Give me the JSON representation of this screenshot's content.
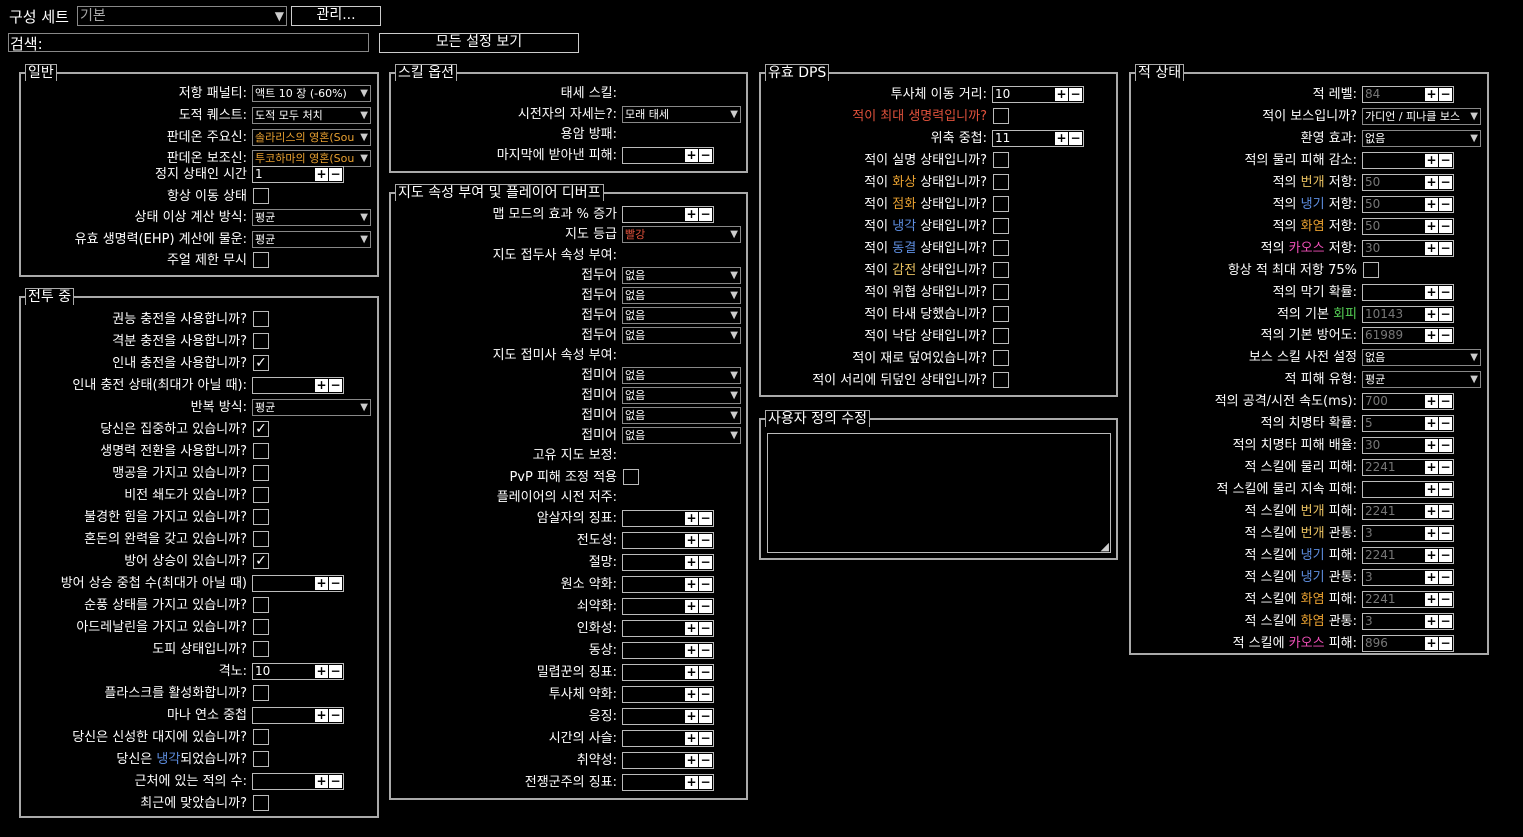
{
  "topbar": {
    "build_label": "구성 세트",
    "build_value": "기본",
    "manage_button": "관리...",
    "search_label": "검색:",
    "search_value": "",
    "show_all_button": "모든 설정 보기"
  },
  "general": {
    "title": "일반",
    "rows": [
      {
        "label": "저항 패널티:",
        "type": "dropdown",
        "value": "액트 10 장 (-60%)"
      },
      {
        "label": "도적 퀘스트:",
        "type": "dropdown",
        "value": "도적 모두 처치"
      },
      {
        "label": "판데온 주요신:",
        "type": "dropdown",
        "value": "솔라리스의 영혼(Sou",
        "color": "#e8a030"
      },
      {
        "label": "판데온 보조신:",
        "type": "dropdown",
        "value": "투코하마의 영혼(Sou",
        "color": "#e8a030"
      },
      {
        "label": "정지 상태인 시간",
        "type": "number",
        "value": "1"
      },
      {
        "label": "항상 이동 상태",
        "type": "check",
        "checked": false
      },
      {
        "label": "상태 이상 계산 방식:",
        "type": "dropdown",
        "value": "평균"
      },
      {
        "label": "유효 생명력(EHP) 계산에 물운:",
        "type": "dropdown",
        "value": "평균"
      },
      {
        "label": "주얼 제한 무시",
        "type": "check",
        "checked": false
      }
    ]
  },
  "combat": {
    "title": "전투 중",
    "rows": [
      {
        "label": "권능 충전을 사용합니까?",
        "type": "check",
        "checked": false
      },
      {
        "label": "격분 충전을 사용합니까?",
        "type": "check",
        "checked": false
      },
      {
        "label": "인내 충전을 사용합니까?",
        "type": "check",
        "checked": true
      },
      {
        "label": "인내 충전 상태(최대가 아닐 때):",
        "type": "number",
        "value": ""
      },
      {
        "label": "반복 방식:",
        "type": "dropdown",
        "value": "평균"
      },
      {
        "label": "당신은 집중하고 있습니까?",
        "type": "check",
        "checked": true
      },
      {
        "label": "생명력 전환을 사용합니까?",
        "type": "check",
        "checked": false
      },
      {
        "label": "맹공을 가지고 있습니까?",
        "type": "check",
        "checked": false
      },
      {
        "label": "비전 쇄도가 있습니까?",
        "type": "check",
        "checked": false
      },
      {
        "label": "불경한 힘을 가지고 있습니까?",
        "type": "check",
        "checked": false
      },
      {
        "label": "혼돈의 완력을 갖고 있습니까?",
        "type": "check",
        "checked": false
      },
      {
        "label": "방어 상승이 있습니까?",
        "type": "check",
        "checked": true
      },
      {
        "label": "방어 상승 중첩 수(최대가 아닐 때)",
        "type": "number",
        "value": ""
      },
      {
        "label": "순풍 상태를 가지고 있습니까?",
        "type": "check",
        "checked": false
      },
      {
        "label": "아드레날린을 가지고 있습니까?",
        "type": "check",
        "checked": false
      },
      {
        "label": "도피 상태입니까?",
        "type": "check",
        "checked": false
      },
      {
        "label": "격노:",
        "type": "number",
        "value": "10"
      },
      {
        "label": "플라스크를 활성화합니까?",
        "type": "check",
        "checked": false
      },
      {
        "label": "마나 연소 중첩",
        "type": "number",
        "value": ""
      },
      {
        "label": "당신은 신성한 대지에 있습니까?",
        "type": "check",
        "checked": false
      },
      {
        "label_parts": [
          "당신은 ",
          "냉각",
          "되었습니까?"
        ],
        "type": "check",
        "checked": false
      },
      {
        "label": "근처에 있는 적의 수:",
        "type": "number",
        "value": ""
      },
      {
        "label": "최근에 맞았습니까?",
        "type": "check",
        "checked": false
      }
    ]
  },
  "skill_options": {
    "title": "스킬 옵션",
    "rows": [
      {
        "label": "태세 스킬:",
        "type": "none"
      },
      {
        "label": "시전자의 자세는?:",
        "type": "dropdown",
        "value": "모래 태세"
      },
      {
        "label": "용암 방패:",
        "type": "none"
      },
      {
        "label": "마지막에 받아낸 피해:",
        "type": "number",
        "value": ""
      }
    ]
  },
  "map_mods": {
    "title": "지도 속성 부여 및 플레이어 디버프",
    "rows": [
      {
        "label": "맵 모드의 효과 % 증가",
        "type": "number",
        "value": ""
      },
      {
        "label": "지도 등급",
        "type": "dropdown",
        "value": "빨강",
        "color": "#e0513b"
      },
      {
        "label": "지도 접두사 속성 부여:",
        "type": "none"
      },
      {
        "label": "접두어",
        "type": "dropdown",
        "value": "없음"
      },
      {
        "label": "접두어",
        "type": "dropdown",
        "value": "없음"
      },
      {
        "label": "접두어",
        "type": "dropdown",
        "value": "없음"
      },
      {
        "label": "접두어",
        "type": "dropdown",
        "value": "없음"
      },
      {
        "label": "지도 접미사 속성 부여:",
        "type": "none"
      },
      {
        "label": "접미어",
        "type": "dropdown",
        "value": "없음"
      },
      {
        "label": "접미어",
        "type": "dropdown",
        "value": "없음"
      },
      {
        "label": "접미어",
        "type": "dropdown",
        "value": "없음"
      },
      {
        "label": "접미어",
        "type": "dropdown",
        "value": "없음"
      },
      {
        "label": "고유 지도 보정:",
        "type": "none"
      },
      {
        "label": "PvP 피해 조정 적용",
        "type": "check",
        "checked": false
      },
      {
        "label": "플레이어의 시전 저주:",
        "type": "none"
      },
      {
        "label": "암살자의 징표:",
        "type": "number",
        "value": ""
      },
      {
        "label": "전도성:",
        "type": "number",
        "value": ""
      },
      {
        "label": "절망:",
        "type": "number",
        "value": ""
      },
      {
        "label": "원소 약화:",
        "type": "number",
        "value": ""
      },
      {
        "label": "쇠약화:",
        "type": "number",
        "value": ""
      },
      {
        "label": "인화성:",
        "type": "number",
        "value": ""
      },
      {
        "label": "동상:",
        "type": "number",
        "value": ""
      },
      {
        "label": "밀렵꾼의 징표:",
        "type": "number",
        "value": ""
      },
      {
        "label": "투사체 약화:",
        "type": "number",
        "value": ""
      },
      {
        "label": "응징:",
        "type": "number",
        "value": ""
      },
      {
        "label": "시간의 사슬:",
        "type": "number",
        "value": ""
      },
      {
        "label": "취약성:",
        "type": "number",
        "value": ""
      },
      {
        "label": "전쟁군주의 징표:",
        "type": "number",
        "value": ""
      }
    ]
  },
  "effective_dps": {
    "title": "유효 DPS",
    "rows": [
      {
        "label": "투사체 이동 거리:",
        "type": "number",
        "value": "10"
      },
      {
        "label": "적이 최대 생명력입니까?",
        "type": "check",
        "checked": false,
        "color": "#e0513b"
      },
      {
        "label": "위축 중첩:",
        "type": "number",
        "value": "11"
      },
      {
        "label": "적이 실명 상태입니까?",
        "type": "check",
        "checked": false
      },
      {
        "label_parts": [
          "적이 ",
          "화상",
          " 상태입니까?"
        ],
        "accent": "orange",
        "type": "check",
        "checked": false
      },
      {
        "label_parts": [
          "적이 ",
          "점화",
          " 상태입니까?"
        ],
        "accent": "orange",
        "type": "check",
        "checked": false
      },
      {
        "label_parts": [
          "적이 ",
          "냉각",
          " 상태입니까?"
        ],
        "accent": "blue",
        "type": "check",
        "checked": false
      },
      {
        "label_parts": [
          "적이 ",
          "동결",
          " 상태입니까?"
        ],
        "accent": "blue",
        "type": "check",
        "checked": false
      },
      {
        "label_parts": [
          "적이 ",
          "감전",
          " 상태입니까?"
        ],
        "accent": "yellow",
        "type": "check",
        "checked": false
      },
      {
        "label": "적이 위협 상태입니까?",
        "type": "check",
        "checked": false
      },
      {
        "label": "적이 타새 당했습니까?",
        "type": "check",
        "checked": false
      },
      {
        "label": "적이 낙담 상태입니까?",
        "type": "check",
        "checked": false
      },
      {
        "label": "적이 재로 덮여있습니까?",
        "type": "check",
        "checked": false
      },
      {
        "label": "적이 서리에 뒤덮인 상태입니까?",
        "type": "check",
        "checked": false
      }
    ]
  },
  "custom_mods": {
    "title": "사용자 정의 수정",
    "value": ""
  },
  "enemy_state": {
    "title": "적 상태",
    "rows": [
      {
        "label": "적 레벨:",
        "type": "number",
        "value": "84",
        "dim": true
      },
      {
        "label": "적이 보스입니까?",
        "type": "dropdown",
        "value": "가디언 / 피나클 보스"
      },
      {
        "label": "환영 효과:",
        "type": "dropdown",
        "value": "없음"
      },
      {
        "label": "적의 물리 피해 감소:",
        "type": "number",
        "value": ""
      },
      {
        "label_parts": [
          "적의 ",
          "번개",
          " 저항:"
        ],
        "accent": "yellow",
        "type": "number",
        "value": "50",
        "dim": true
      },
      {
        "label_parts": [
          "적의 ",
          "냉기",
          " 저항:"
        ],
        "accent": "blue",
        "type": "number",
        "value": "50",
        "dim": true
      },
      {
        "label_parts": [
          "적의 ",
          "화염",
          " 저항:"
        ],
        "accent": "orange",
        "type": "number",
        "value": "50",
        "dim": true
      },
      {
        "label_parts": [
          "적의 ",
          "카오스",
          " 저항:"
        ],
        "accent": "pink",
        "type": "number",
        "value": "30",
        "dim": true
      },
      {
        "label": "항상 적 최대 저항 75%",
        "type": "check",
        "checked": false
      },
      {
        "label": "적의 막기 확률:",
        "type": "number",
        "value": ""
      },
      {
        "label_parts": [
          "적의 기본 ",
          "회피",
          ""
        ],
        "accent": "green",
        "type": "number",
        "value": "10143",
        "dim": true
      },
      {
        "label": "적의 기본 방어도:",
        "type": "number",
        "value": "61989",
        "dim": true
      },
      {
        "label": "보스 스킬 사전 설정",
        "type": "dropdown",
        "value": "없음"
      },
      {
        "label": "적 피해 유형:",
        "type": "dropdown",
        "value": "평균"
      },
      {
        "label": "적의 공격/시전 속도(ms):",
        "type": "number",
        "value": "700",
        "dim": true
      },
      {
        "label": "적의 치명타 확률:",
        "type": "number",
        "value": "5",
        "dim": true
      },
      {
        "label": "적의 치명타 피해 배율:",
        "type": "number",
        "value": "30",
        "dim": true
      },
      {
        "label": "적 스킬에 물리 피해:",
        "type": "number",
        "value": "2241",
        "dim": true
      },
      {
        "label": "적 스킬에 물리 지속 피해:",
        "type": "number",
        "value": ""
      },
      {
        "label_parts": [
          "적 스킬에 ",
          "번개",
          " 피해:"
        ],
        "accent": "yellow",
        "type": "number",
        "value": "2241",
        "dim": true
      },
      {
        "label_parts": [
          "적 스킬에 ",
          "번개",
          " 관통:"
        ],
        "accent": "yellow",
        "type": "number",
        "value": "3",
        "dim": true
      },
      {
        "label_parts": [
          "적 스킬에 ",
          "냉기",
          " 피해:"
        ],
        "accent": "blue",
        "type": "number",
        "value": "2241",
        "dim": true
      },
      {
        "label_parts": [
          "적 스킬에 ",
          "냉기",
          " 관통:"
        ],
        "accent": "blue",
        "type": "number",
        "value": "3",
        "dim": true
      },
      {
        "label_parts": [
          "적 스킬에 ",
          "화염",
          " 피해:"
        ],
        "accent": "orange",
        "type": "number",
        "value": "2241",
        "dim": true
      },
      {
        "label_parts": [
          "적 스킬에 ",
          "화염",
          " 관통:"
        ],
        "accent": "orange",
        "type": "number",
        "value": "3",
        "dim": true
      },
      {
        "label_parts": [
          "적 스킬에 ",
          "카오스",
          " 피해:"
        ],
        "accent": "pink",
        "type": "number",
        "value": "896",
        "dim": true
      }
    ]
  },
  "colors": {
    "orange": "#e8a030",
    "blue": "#5e8ee0",
    "yellow": "#e8c060",
    "green": "#55d055",
    "pink": "#f050b8",
    "red": "#e0513b"
  },
  "icons": {
    "dropdown_arrow": "▼",
    "plus": "+",
    "minus": "−",
    "check": "✓",
    "resize": "◢"
  }
}
